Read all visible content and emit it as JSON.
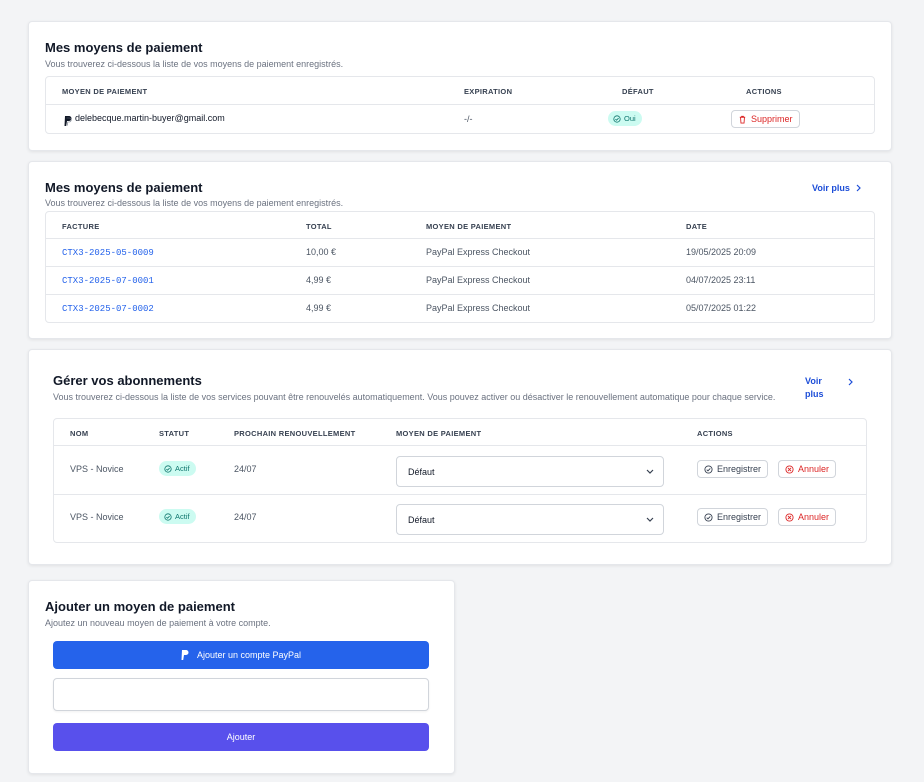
{
  "payment_methods": {
    "title": "Mes moyens de paiement",
    "subtitle": "Vous trouverez ci-dessous la liste de vos moyens de paiement enregistrés.",
    "columns": [
      "MOYEN DE PAIEMENT",
      "EXPIRATION",
      "DÉFAUT",
      "ACTIONS"
    ],
    "rows": [
      {
        "method": "delebecque.martin-buyer@gmail.com",
        "expiration": "-/-",
        "default": "Oui",
        "action": "Supprimer"
      }
    ]
  },
  "invoices": {
    "title": "Mes moyens de paiement",
    "subtitle": "Vous trouverez ci-dessous la liste de vos moyens de paiement enregistrés.",
    "see_more": "Voir plus",
    "columns": [
      "FACTURE",
      "TOTAL",
      "MOYEN DE PAIEMENT",
      "DATE"
    ],
    "rows": [
      {
        "invoice": "CTX3-2025-05-0009",
        "total": "10,00 €",
        "method": "PayPal Express Checkout",
        "date": "19/05/2025 20:09"
      },
      {
        "invoice": "CTX3-2025-07-0001",
        "total": "4,99 €",
        "method": "PayPal Express Checkout",
        "date": "04/07/2025 23:11"
      },
      {
        "invoice": "CTX3-2025-07-0002",
        "total": "4,99 €",
        "method": "PayPal Express Checkout",
        "date": "05/07/2025 01:22"
      }
    ]
  },
  "subscriptions": {
    "title": "Gérer vos abonnements",
    "subtitle": "Vous trouverez ci-dessous la liste de vos services pouvant être renouvelés automatiquement. Vous pouvez activer ou désactiver le renouvellement automatique pour chaque service.",
    "see_more_1": "Voir",
    "see_more_2": "plus",
    "columns": [
      "NOM",
      "STATUT",
      "PROCHAIN RENOUVELLEMENT",
      "MOYEN DE PAIEMENT",
      "ACTIONS"
    ],
    "rows": [
      {
        "name": "VPS - Novice",
        "status": "Actif",
        "renewal": "24/07",
        "payment": "Défaut",
        "save": "Enregistrer",
        "cancel": "Annuler"
      },
      {
        "name": "VPS - Novice",
        "status": "Actif",
        "renewal": "24/07",
        "payment": "Défaut",
        "save": "Enregistrer",
        "cancel": "Annuler"
      }
    ]
  },
  "add_method": {
    "title": "Ajouter un moyen de paiement",
    "subtitle": "Ajoutez un nouveau moyen de paiement à votre compte.",
    "paypal_button": "Ajouter un compte PayPal",
    "input_value": "",
    "submit_button": "Ajouter"
  },
  "colors": {
    "primary_blue": "#2563eb",
    "indigo": "#5850ec",
    "danger": "#dc2626",
    "badge_bg": "#ccfbf1",
    "badge_text": "#0f766e"
  }
}
